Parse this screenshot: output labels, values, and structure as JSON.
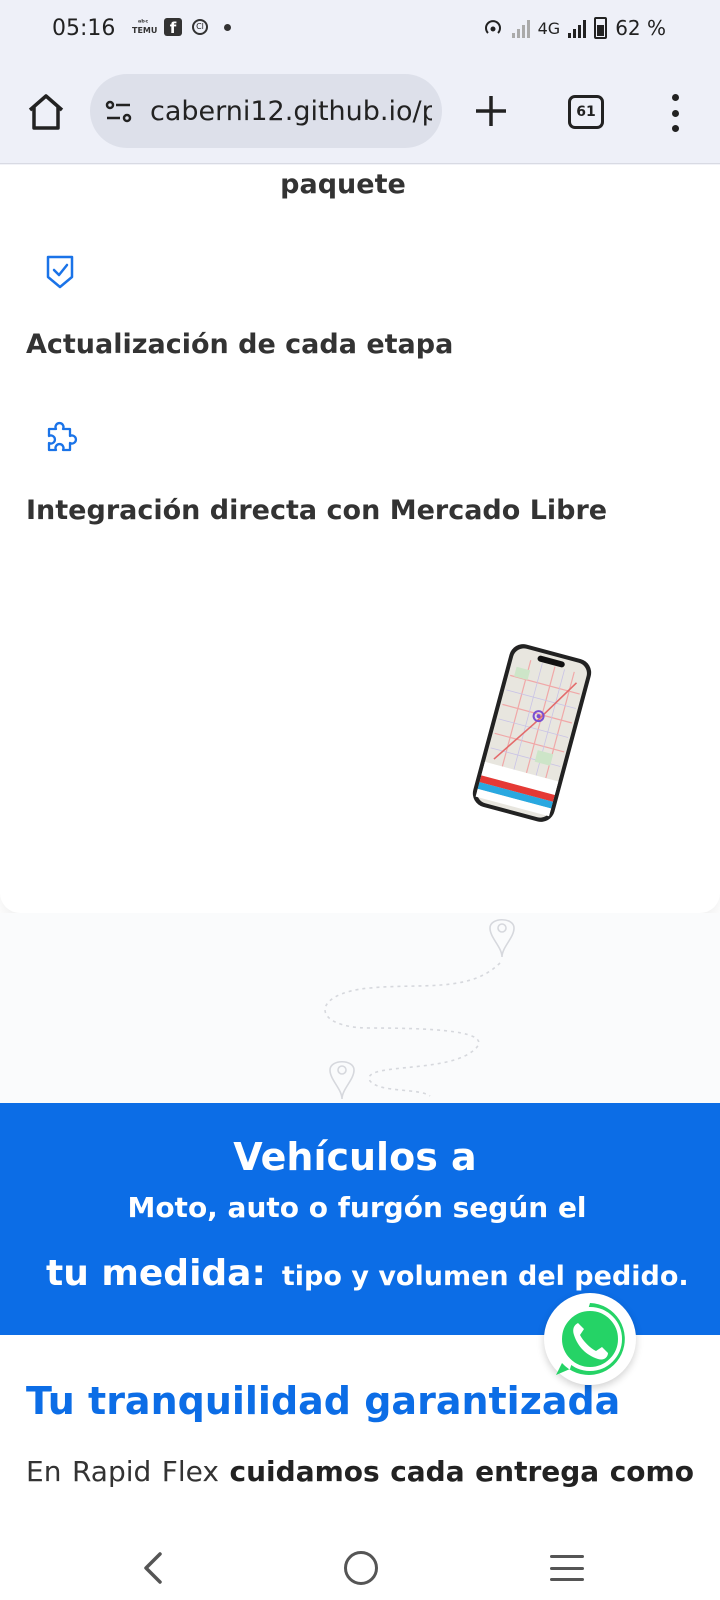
{
  "status_bar": {
    "time": "05:16",
    "temu_label": "TEMU",
    "network": "4G",
    "battery": "62 %"
  },
  "browser": {
    "url": "caberni12.github.io/p",
    "tab_count": "61"
  },
  "features": {
    "top_text": "paquete",
    "items": [
      {
        "title": "Actualización de cada etapa",
        "icon": "shield-check-icon"
      },
      {
        "title": "Integración directa con Mercado Libre",
        "icon": "puzzle-icon"
      }
    ]
  },
  "banner": {
    "title": "Vehículos a",
    "subtitle": "Moto, auto o furgón según el",
    "highlight": "tu medida:",
    "highlight_rest": "tipo y volumen del pedido."
  },
  "section": {
    "title": "Tu tranquilidad garantizada",
    "text_words": [
      {
        "text": "En",
        "bold": false
      },
      {
        "text": "Rapid",
        "bold": false
      },
      {
        "text": "Flex",
        "bold": false
      },
      {
        "text": "cuidamos",
        "bold": true
      },
      {
        "text": "cada",
        "bold": true
      },
      {
        "text": "entrega",
        "bold": true
      },
      {
        "text": "como",
        "bold": true
      }
    ]
  },
  "colors": {
    "brand_blue": "#0c6de6",
    "whatsapp_green": "#25d366"
  }
}
